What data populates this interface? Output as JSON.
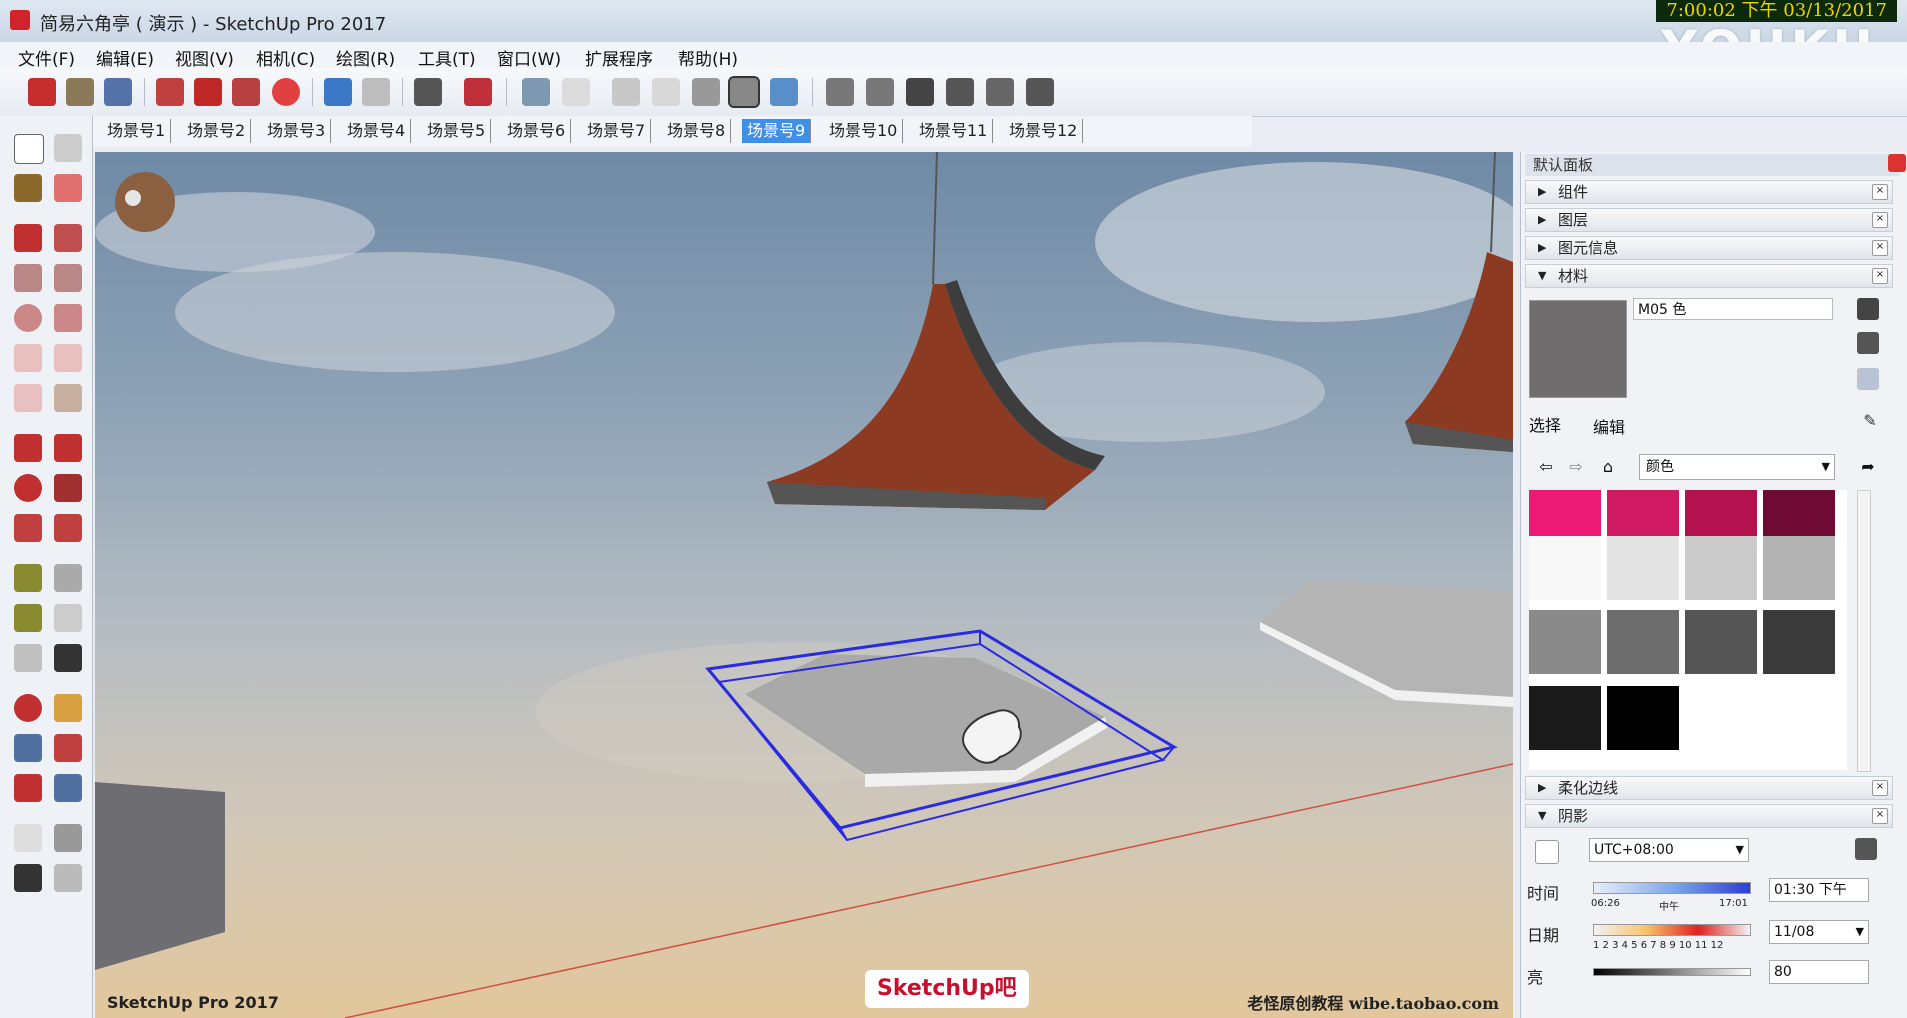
{
  "window": {
    "title": "简易六角亭 ( 演示 ) - SketchUp Pro 2017",
    "clock": "7:00:02 下午 03/13/2017",
    "watermark": "YOUKU"
  },
  "menu": [
    "文件(F)",
    "编辑(E)",
    "视图(V)",
    "相机(C)",
    "绘图(R)",
    "工具(T)",
    "窗口(W)",
    "扩展程序",
    "帮助(H)"
  ],
  "scenes": {
    "tabs": [
      "场景号1",
      "场景号2",
      "场景号3",
      "场景号4",
      "场景号5",
      "场景号6",
      "场景号7",
      "场景号8",
      "场景号9",
      "场景号10",
      "场景号11",
      "场景号12"
    ],
    "active_index": 8
  },
  "viewport": {
    "label": "SketchUp Pro 2017",
    "brand": "SketchUp吧",
    "credit": "老怪原创教程  wibe.taobao.com"
  },
  "tray": {
    "title": "默认面板",
    "panels": [
      "组件",
      "图层",
      "图元信息",
      "材料"
    ],
    "material_name": "M05 色",
    "tabs": [
      "选择",
      "编辑"
    ],
    "library": "颜色",
    "swatches": [
      "#ec1a73",
      "#cf1a62",
      "#b3124f",
      "#6e0a33",
      "#f8f8f8",
      "#e3e3e3",
      "#cbcbcb",
      "#b3b3b3",
      "#8a8a8a",
      "#6e6e6e",
      "#555555",
      "#3a3a3a",
      "#1b1b1b",
      "#000000"
    ],
    "lower_panels": [
      "柔化边线",
      "阴影"
    ],
    "shadow": {
      "timezone": "UTC+08:00",
      "time_label": "时间",
      "time_ticks": [
        "06:26",
        "中午",
        "17:01"
      ],
      "time_value": "01:30 下午",
      "date_label": "日期",
      "date_ticks": "1 2 3 4 5 6 7 8 9 10 11 12",
      "date_value": "11/08",
      "light_label": "亮",
      "light_value": "80"
    }
  }
}
